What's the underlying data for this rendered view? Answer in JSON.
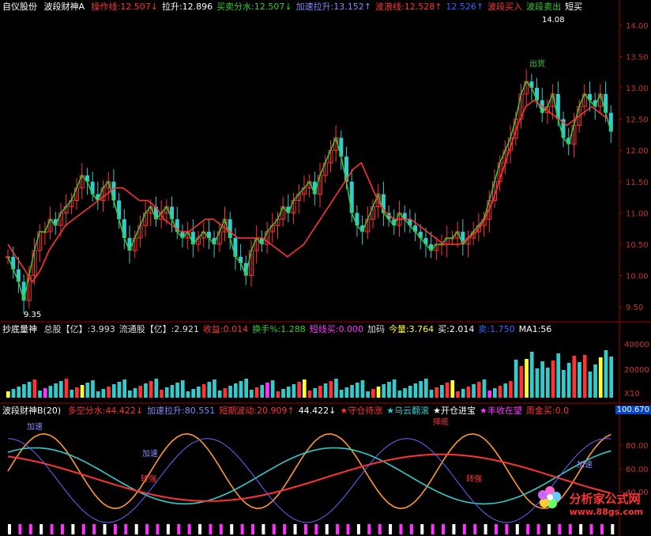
{
  "panel1": {
    "title": "自仪股份",
    "indicator": "波段财神A",
    "items": [
      {
        "label": "操作线",
        "value": "12.507",
        "arrow": "↓",
        "color": "#ff3333"
      },
      {
        "label": "拉升",
        "value": "12.896",
        "arrow": "",
        "color": "#ffffff"
      },
      {
        "label": "买卖分水",
        "value": "12.507",
        "arrow": "↓",
        "color": "#33cc33"
      },
      {
        "label": "加速拉升",
        "value": "13.152",
        "arrow": "↑",
        "color": "#8888ff"
      },
      {
        "label": "波浪线",
        "value": "12.528",
        "arrow": "↑",
        "color": "#ff3333"
      },
      {
        "label": "",
        "value": "12.526",
        "arrow": "↑",
        "color": "#3366ff"
      },
      {
        "label": "波段买入",
        "value": "",
        "arrow": "",
        "color": "#ff3333"
      },
      {
        "label": "波段卖出",
        "value": "",
        "arrow": "",
        "color": "#33cc33"
      },
      {
        "label": "短买",
        "value": "",
        "arrow": "",
        "color": "#ffffff"
      }
    ],
    "yticks": [
      "14.00",
      "13.50",
      "13.00",
      "12.50",
      "12.00",
      "11.50",
      "11.00",
      "10.50",
      "10.00",
      "9.50"
    ],
    "annotations": {
      "high": "14.08",
      "low": "9.35",
      "sell": "出货"
    }
  },
  "panel2": {
    "title": "抄底量神",
    "items": [
      {
        "label": "总股【亿】",
        "value": "3.993",
        "color": "#dddddd"
      },
      {
        "label": "流通股【亿】",
        "value": "2.921",
        "color": "#dddddd"
      },
      {
        "label": "收益",
        "value": "0.014",
        "color": "#ff3333"
      },
      {
        "label": "换手%",
        "value": "1.288",
        "color": "#33cc33"
      },
      {
        "label": "短线买",
        "value": "0.000",
        "color": "#ff33ff"
      },
      {
        "label": "加码",
        "value": "",
        "color": "#dddddd"
      },
      {
        "label": "今量",
        "value": "3.764",
        "color": "#ffff33"
      },
      {
        "label": "买",
        "value": "2.014",
        "color": "#ffffff"
      },
      {
        "label": "卖",
        "value": "1.750",
        "color": "#3366ff"
      },
      {
        "label": "MA1",
        "value": "56",
        "color": "#ffffff"
      }
    ],
    "yticks": [
      "40000",
      "20000",
      "X10"
    ]
  },
  "panel3": {
    "title": "波段财神B(20)",
    "items": [
      {
        "label": "多空分水",
        "value": "44.422",
        "arrow": "↓",
        "color": "#ff3333"
      },
      {
        "label": "加速拉升",
        "value": "80.551",
        "arrow": "",
        "color": "#8888ff"
      },
      {
        "label": "短期波动",
        "value": "20.909",
        "arrow": "↑",
        "color": "#ff3333"
      },
      {
        "label": "",
        "value": "44.422",
        "arrow": "↓",
        "color": "#ffffff"
      },
      {
        "label": "★守仓待涨",
        "value": "",
        "arrow": "",
        "color": "#ff3333"
      },
      {
        "label": "★乌云翻滚",
        "value": "",
        "arrow": "",
        "color": "#33cccc"
      },
      {
        "label": "★开仓进宝",
        "value": "",
        "arrow": "",
        "color": "#ffffff"
      },
      {
        "label": "★丰收在望",
        "value": "",
        "arrow": "",
        "color": "#ff33ff"
      },
      {
        "label": "周金买",
        "value": "0.0",
        "arrow": "",
        "color": "#ff3333"
      }
    ],
    "yticks": [
      "80.00",
      "60.00",
      "40.00"
    ],
    "current": "100.670",
    "tags": {
      "accel": "加速",
      "strong": "转强",
      "bottom": "择底"
    }
  },
  "watermark": {
    "name": "分析家公式网",
    "url": "www.88gs.com"
  },
  "chart_data": {
    "type": "line",
    "title": "自仪股份",
    "ylim": [
      9.3,
      14.2
    ],
    "x": [
      1,
      2,
      3,
      4,
      5,
      6,
      7,
      8,
      9,
      10,
      11,
      12,
      13,
      14,
      15,
      16,
      17,
      18,
      19,
      20,
      21,
      22,
      23,
      24,
      25,
      26,
      27,
      28,
      29,
      30,
      31,
      32,
      33,
      34,
      35,
      36,
      37,
      38,
      39,
      40,
      41,
      42,
      43,
      44,
      45,
      46,
      47,
      48,
      49,
      50,
      51,
      52,
      53,
      54,
      55,
      56,
      57,
      58,
      59,
      60,
      61,
      62,
      63,
      64,
      65,
      66,
      67,
      68,
      69,
      70,
      71,
      72,
      73,
      74,
      75,
      76,
      77,
      78,
      79,
      80,
      81,
      82,
      83,
      84,
      85,
      86,
      87,
      88,
      89,
      90,
      91,
      92,
      93,
      94,
      95,
      96,
      97,
      98,
      99,
      100,
      101,
      102,
      103,
      104,
      105,
      106,
      107,
      108,
      109,
      110,
      111,
      112,
      113,
      114,
      115,
      116,
      117,
      118,
      119,
      120,
      121,
      122,
      123,
      124,
      125,
      126,
      127,
      128,
      129,
      130,
      131,
      132,
      133,
      134,
      135,
      136,
      137,
      138,
      139,
      140
    ],
    "series": [
      {
        "name": "收盘",
        "values": [
          10.3,
          10.1,
          9.9,
          9.6,
          10.0,
          10.4,
          10.7,
          10.7,
          10.9,
          10.8,
          11.0,
          11.1,
          11.2,
          11.4,
          11.6,
          11.5,
          11.3,
          11.2,
          11.4,
          11.5,
          11.2,
          10.9,
          10.6,
          10.4,
          10.6,
          10.8,
          11.0,
          11.1,
          10.9,
          11.0,
          11.1,
          10.9,
          10.7,
          10.6,
          10.7,
          10.5,
          10.6,
          10.7,
          10.6,
          10.5,
          10.7,
          10.9,
          10.6,
          10.3,
          10.2,
          10.0,
          10.4,
          10.6,
          10.5,
          10.7,
          10.8,
          10.9,
          11.1,
          11.0,
          11.2,
          11.3,
          11.4,
          11.5,
          11.3,
          11.6,
          11.8,
          12.0,
          12.2,
          11.9,
          11.5,
          11.0,
          10.8,
          10.7,
          10.9,
          11.1,
          11.3,
          11.0,
          10.9,
          10.8,
          11.0,
          10.9,
          10.8,
          10.7,
          10.6,
          10.5,
          10.4,
          10.5,
          10.5,
          10.6,
          10.6,
          10.7,
          10.5,
          10.6,
          10.7,
          10.8,
          10.9,
          11.2,
          11.5,
          11.8,
          12.0,
          12.2,
          12.5,
          12.9,
          13.1,
          13.0,
          12.8,
          12.6,
          12.7,
          12.9,
          12.5,
          12.2,
          12.1,
          12.4,
          12.7,
          12.9,
          12.8,
          12.7,
          12.9,
          12.6,
          12.3
        ],
        "color": "#33cc33"
      },
      {
        "name": "操作线",
        "values": [
          10.5,
          10.3,
          10.1,
          9.9,
          10.1,
          10.4,
          10.6,
          10.8,
          10.9,
          11.0,
          11.1,
          11.2,
          11.3,
          11.4,
          11.4,
          11.3,
          11.2,
          11.2,
          11.1,
          10.9,
          10.8,
          10.7,
          10.7,
          10.8,
          10.9,
          10.9,
          10.8,
          10.7,
          10.6,
          10.6,
          10.6,
          10.6,
          10.5,
          10.4,
          10.3,
          10.4,
          10.5,
          10.7,
          10.9,
          11.1,
          11.3,
          11.5,
          11.7,
          11.8,
          11.5,
          11.2,
          11.0,
          10.9,
          10.9,
          10.9,
          10.8,
          10.7,
          10.6,
          10.5,
          10.5,
          10.5,
          10.6,
          10.7,
          10.9,
          11.2,
          11.6,
          12.0,
          12.4,
          12.7,
          12.8,
          12.7,
          12.6,
          12.5,
          12.4,
          12.5,
          12.6,
          12.7,
          12.6,
          12.5
        ],
        "color": "#ff3333"
      }
    ]
  }
}
